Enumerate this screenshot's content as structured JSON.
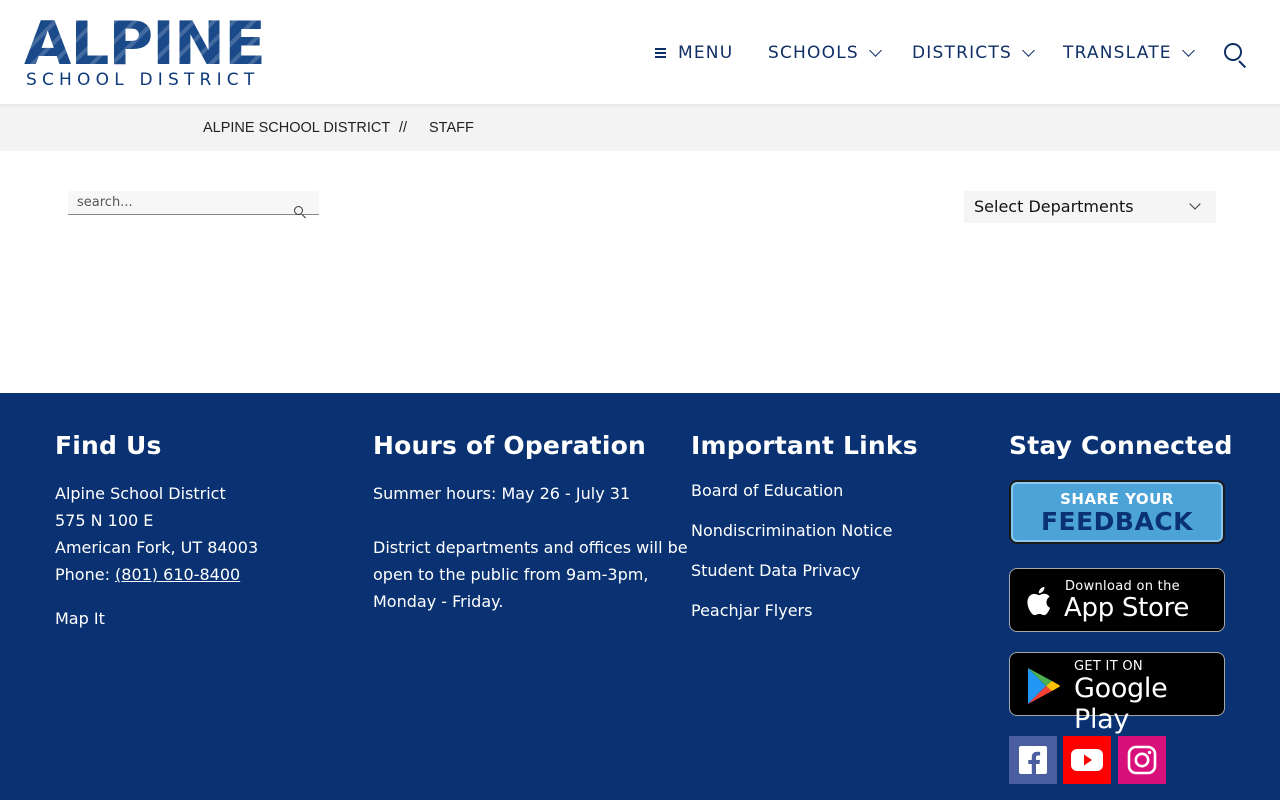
{
  "header": {
    "logo_main": "ALPINE",
    "logo_sub": "SCHOOL DISTRICT",
    "nav": {
      "menu": "MENU",
      "schools": "SCHOOLS",
      "districts": "DISTRICTS",
      "translate": "TRANSLATE"
    }
  },
  "breadcrumb": {
    "items": [
      "ALPINE SCHOOL DISTRICT",
      "STAFF"
    ],
    "separator": "//"
  },
  "directory": {
    "search_placeholder": "search...",
    "select_value": "Select Departments"
  },
  "footer": {
    "background": "#0a3272",
    "find_us": {
      "heading": "Find Us",
      "name": "Alpine School District",
      "street": "575 N 100 E",
      "city": "American Fork, UT 84003",
      "phone_label": "Phone:",
      "phone": "(801) 610-8400",
      "map_link": "Map It"
    },
    "hours": {
      "heading": "Hours of Operation",
      "summer": "Summer hours: May 26 - July 31",
      "line1": "District departments and offices will be",
      "line2": "open to the public from 9am-3pm,",
      "line3": "Monday - Friday."
    },
    "links": {
      "heading": "Important Links",
      "items": [
        "Board of Education",
        "Nondiscrimination Notice",
        "Student Data Privacy",
        "Peachjar Flyers"
      ]
    },
    "connected": {
      "heading": "Stay Connected",
      "feedback_line1": "SHARE YOUR",
      "feedback_line2": "FEEDBACK",
      "appstore_small": "Download on the",
      "appstore_big": "App Store",
      "play_small": "GET IT ON",
      "play_big": "Google Play",
      "social_icons": [
        "facebook-icon",
        "youtube-icon",
        "instagram-icon"
      ]
    }
  }
}
